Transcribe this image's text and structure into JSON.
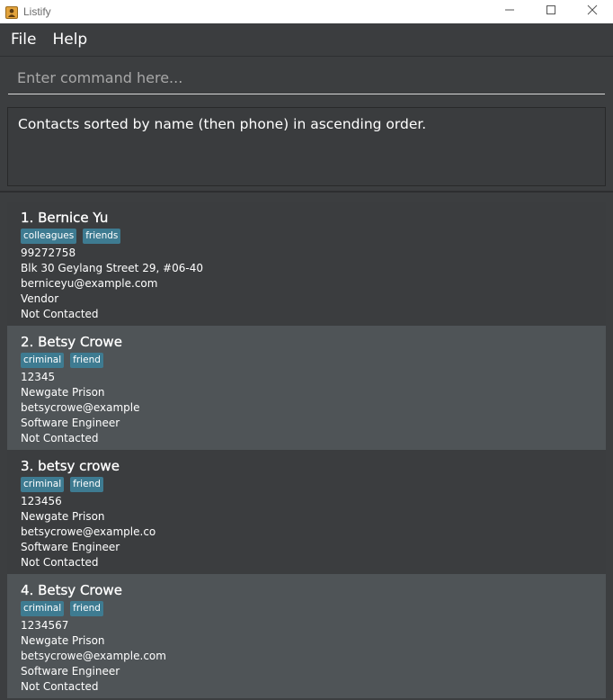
{
  "window": {
    "title": "Listify",
    "icon": "app-icon",
    "controls": [
      "minimize-icon",
      "maximize-icon",
      "close-icon"
    ]
  },
  "menu": {
    "items": [
      {
        "label": "File"
      },
      {
        "label": "Help"
      }
    ]
  },
  "command": {
    "placeholder": "Enter command here...",
    "value": ""
  },
  "result": {
    "message": "Contacts sorted by name (then phone) in ascending order."
  },
  "colors": {
    "background": "#3c3e40",
    "card_alt": "#4f5457",
    "tag": "#3e7b91"
  },
  "persons": [
    {
      "index_name": "1.  Bernice Yu",
      "tags": [
        "colleagues",
        "friends"
      ],
      "phone": "99272758",
      "address": "Blk 30 Geylang Street 29, #06-40",
      "email": "berniceyu@example.com",
      "role": "Vendor",
      "status": "Not Contacted"
    },
    {
      "index_name": "2.  Betsy Crowe",
      "tags": [
        "criminal",
        "friend"
      ],
      "phone": "12345",
      "address": "Newgate Prison",
      "email": "betsycrowe@example",
      "role": "Software Engineer",
      "status": "Not Contacted"
    },
    {
      "index_name": "3.  betsy crowe",
      "tags": [
        "criminal",
        "friend"
      ],
      "phone": "123456",
      "address": "Newgate Prison",
      "email": "betsycrowe@example.co",
      "role": "Software Engineer",
      "status": "Not Contacted"
    },
    {
      "index_name": "4.  Betsy Crowe",
      "tags": [
        "criminal",
        "friend"
      ],
      "phone": "1234567",
      "address": "Newgate Prison",
      "email": "betsycrowe@example.com",
      "role": "Software Engineer",
      "status": "Not Contacted"
    }
  ]
}
